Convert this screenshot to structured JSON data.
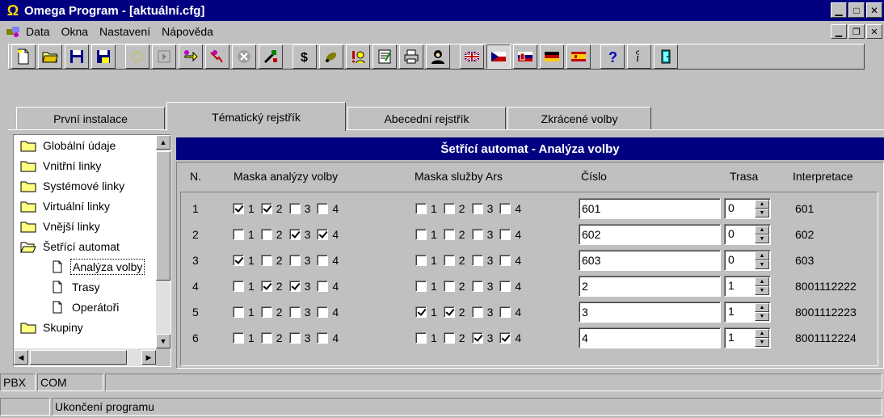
{
  "window": {
    "title": "Omega Program - [aktuální.cfg]",
    "title_icon": "omega-icon"
  },
  "menu": {
    "items": [
      "Data",
      "Okna",
      "Nastavení",
      "Nápověda"
    ]
  },
  "toolbar": {
    "buttons": [
      "new-document-icon",
      "open-folder-icon",
      "save-icon",
      "save-as-icon",
      "connect-icon",
      "play-icon",
      "refresh-icon",
      "transfer-icon",
      "stop-icon",
      "tools-icon",
      "dollar-icon",
      "pen-icon",
      "user-alert-icon",
      "edit-document-icon",
      "printer-icon",
      "person-icon",
      "flag-uk-icon",
      "flag-cz-icon",
      "flag-sk-icon",
      "flag-de-icon",
      "flag-es-icon",
      "help-icon",
      "info-icon",
      "exit-door-icon"
    ]
  },
  "tabs": [
    "První instalace",
    "Tématický rejstřík",
    "Abecední rejstřík",
    "Zkrácené volby"
  ],
  "tree": {
    "items": [
      {
        "label": "Globální údaje",
        "icon": "folder-icon",
        "level": 0
      },
      {
        "label": "Vnitřní linky",
        "icon": "folder-icon",
        "level": 0
      },
      {
        "label": "Systémové linky",
        "icon": "folder-icon",
        "level": 0
      },
      {
        "label": "Virtuální linky",
        "icon": "folder-icon",
        "level": 0
      },
      {
        "label": "Vnější linky",
        "icon": "folder-icon",
        "level": 0
      },
      {
        "label": "Šetřící automat",
        "icon": "open-folder-icon",
        "level": 0
      },
      {
        "label": "Analýza volby",
        "icon": "document-icon",
        "level": 1,
        "selected": true
      },
      {
        "label": "Trasy",
        "icon": "document-icon",
        "level": 1
      },
      {
        "label": "Operátoři",
        "icon": "document-icon",
        "level": 1
      },
      {
        "label": "Skupiny",
        "icon": "folder-icon",
        "level": 0
      }
    ]
  },
  "panel": {
    "title": "Šetřící automat - Analýza volby",
    "columns": {
      "n": "N.",
      "mask_analysis": "Maska analýzy volby",
      "mask_service": "Maska služby Ars",
      "number": "Číslo",
      "route": "Trasa",
      "interpretation": "Interpretace"
    },
    "checkbox_labels": [
      "1",
      "2",
      "3",
      "4"
    ],
    "rows": [
      {
        "n": "1",
        "mask_analysis": [
          true,
          true,
          false,
          false
        ],
        "mask_service": [
          false,
          false,
          false,
          false
        ],
        "number": "601",
        "route": "0",
        "interpretation": "601"
      },
      {
        "n": "2",
        "mask_analysis": [
          false,
          false,
          true,
          true
        ],
        "mask_service": [
          false,
          false,
          false,
          false
        ],
        "number": "602",
        "route": "0",
        "interpretation": "602"
      },
      {
        "n": "3",
        "mask_analysis": [
          true,
          false,
          false,
          false
        ],
        "mask_service": [
          false,
          false,
          false,
          false
        ],
        "number": "603",
        "route": "0",
        "interpretation": "603"
      },
      {
        "n": "4",
        "mask_analysis": [
          false,
          true,
          true,
          false
        ],
        "mask_service": [
          false,
          false,
          false,
          false
        ],
        "number": "2",
        "route": "1",
        "interpretation": "8001112222"
      },
      {
        "n": "5",
        "mask_analysis": [
          false,
          false,
          false,
          false
        ],
        "mask_service": [
          true,
          true,
          false,
          false
        ],
        "number": "3",
        "route": "1",
        "interpretation": "8001112223"
      },
      {
        "n": "6",
        "mask_analysis": [
          false,
          false,
          false,
          false
        ],
        "mask_service": [
          false,
          false,
          true,
          true
        ],
        "number": "4",
        "route": "1",
        "interpretation": "8001112224"
      }
    ]
  },
  "pbx_bar": {
    "pane1": "PBX",
    "pane2": "COM"
  },
  "status_bar": {
    "message": "Ukončení programu"
  }
}
